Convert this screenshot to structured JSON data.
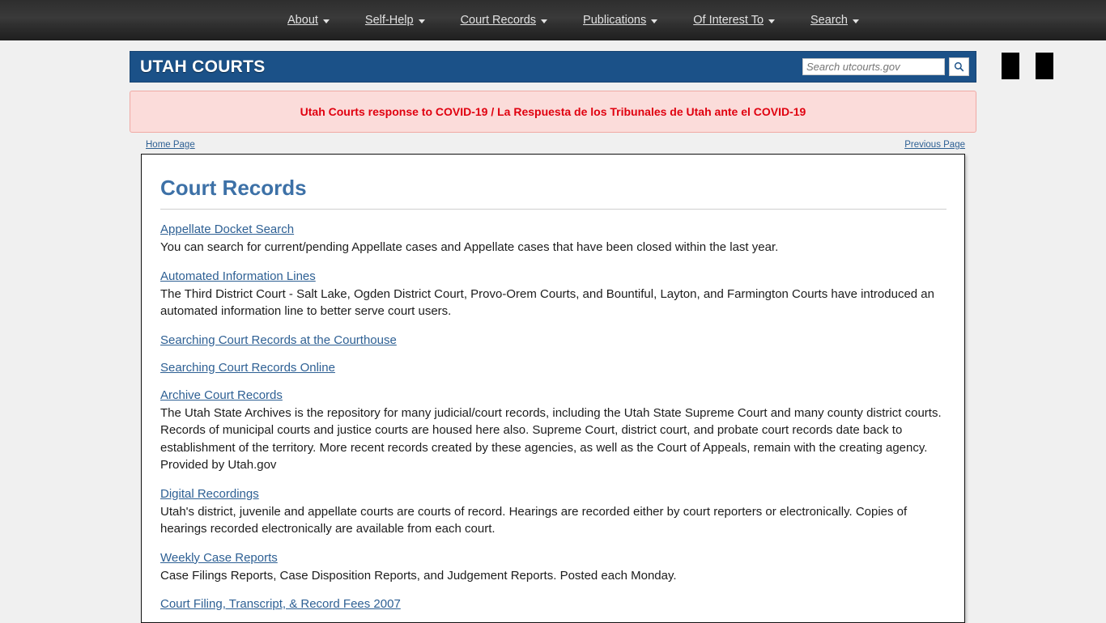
{
  "topnav": {
    "items": [
      {
        "label": "About",
        "caret": "chevron-down-icon"
      },
      {
        "label": "Self-Help",
        "caret": "chevron-down-icon"
      },
      {
        "label": "Court Records",
        "caret": "chevron-down-icon"
      },
      {
        "label": "Publications",
        "caret": "chevron-down-icon"
      },
      {
        "label": "Of Interest To",
        "caret": "chevron-down-icon"
      },
      {
        "label": "Search",
        "caret": "chevron-down-icon"
      }
    ]
  },
  "header": {
    "brand": "UTAH COURTS",
    "brand_bg": "#1b5188",
    "search": {
      "placeholder": "Search utcourts.gov",
      "value": "",
      "button_icon": "search-icon"
    },
    "broken_images": [
      "broken-image-placeholder",
      "broken-image-placeholder"
    ]
  },
  "alert": {
    "text": "Utah Courts response to COVID-19 / La Respuesta de los Tribunales de Utah ante el COVID-19",
    "text_color": "#e0000f",
    "background": "#fbdcda",
    "border_color": "#f0a9a4"
  },
  "breadcrumbs": {
    "home": "Home Page",
    "previous": "Previous Page"
  },
  "main": {
    "title": "Court Records",
    "title_color": "#3d71a7",
    "entries": [
      {
        "link": "Appellate Docket Search",
        "desc": "You can search for current/pending Appellate cases and Appellate cases that have been closed within the last year."
      },
      {
        "link": "Automated Information Lines",
        "desc": "The Third District Court - Salt Lake, Ogden District Court, Provo-Orem Courts, and Bountiful, Layton, and Farmington Courts have introduced an automated information line to better serve court users."
      },
      {
        "link": "Searching Court Records at the Courthouse",
        "desc": ""
      },
      {
        "link": "Searching Court Records Online",
        "desc": ""
      },
      {
        "link": "Archive Court Records",
        "desc": "The Utah State Archives is the repository for many judicial/court records, including the Utah State Supreme Court and many county district courts. Records of municipal courts and justice courts are housed here also. Supreme Court, district court, and probate court records date back to establishment of the territory. More recent records created by these agencies, as well as the Court of Appeals, remain with the creating agency. Provided by Utah.gov"
      },
      {
        "link": "Digital Recordings",
        "desc": "Utah's district, juvenile and appellate courts are courts of record. Hearings are recorded either by court reporters or electronically. Copies of hearings recorded electronically are available from each court."
      },
      {
        "link": "Weekly Case Reports",
        "desc": "Case Filings Reports, Case Disposition Reports, and Judgement Reports. Posted each Monday."
      },
      {
        "link": "Court Filing, Transcript, & Record Fees 2007",
        "desc": ""
      }
    ]
  }
}
